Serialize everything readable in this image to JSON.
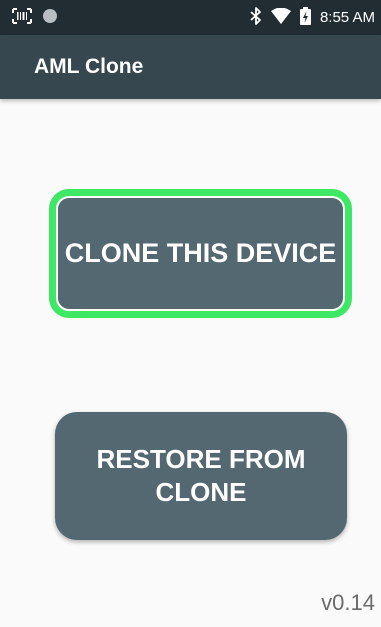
{
  "status_bar": {
    "time": "8:55 AM",
    "left_icons": [
      "barcode-scanner-icon",
      "circle-notification-icon"
    ],
    "right_icons": [
      "bluetooth-icon",
      "wifi-icon",
      "battery-charging-icon"
    ]
  },
  "app_bar": {
    "title": "AML Clone",
    "background": "#37474f"
  },
  "main": {
    "clone_button_label": "CLONE THIS DEVICE",
    "restore_button_label": "RESTORE FROM CLONE",
    "version": "v0.14",
    "button_color": "#546872",
    "focus_ring_color": "#3ee864"
  }
}
